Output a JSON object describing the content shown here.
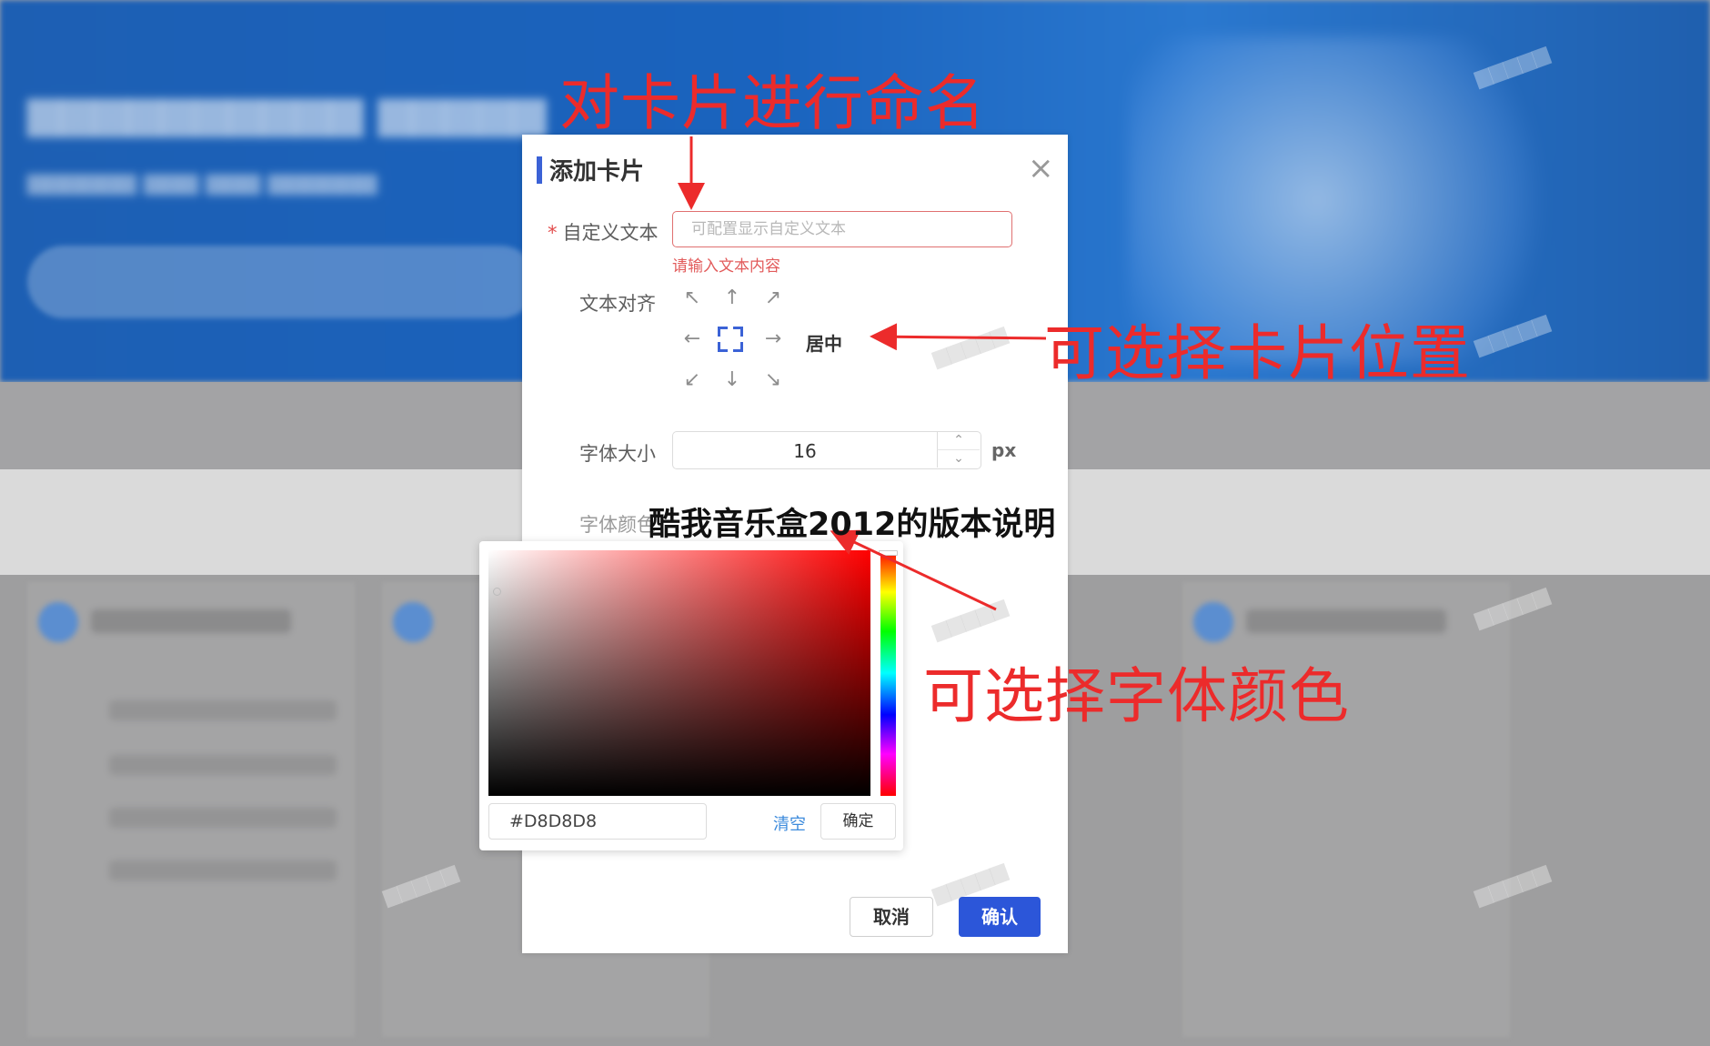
{
  "dialog": {
    "title": "添加卡片",
    "close_icon": "close-icon",
    "custom_text": {
      "label": "自定义文本",
      "required_mark": "*",
      "placeholder": "可配置显示自定义文本",
      "value": "",
      "error": "请输入文本内容"
    },
    "text_align": {
      "label": "文本对齐",
      "selected": "居中",
      "options": [
        "top-left",
        "top",
        "top-right",
        "left",
        "center",
        "right",
        "bottom-left",
        "bottom",
        "bottom-right"
      ]
    },
    "font_size": {
      "label": "字体大小",
      "value": "16",
      "unit": "px"
    },
    "font_color": {
      "label": "字体颜色"
    },
    "cancel_label": "取消",
    "confirm_label": "确认"
  },
  "color_picker": {
    "hue_color": "#FF0000",
    "hex_value": "#D8D8D8",
    "clear_label": "清空",
    "ok_label": "确定"
  },
  "annotations": {
    "rename_card": "对卡片进行命名",
    "choose_position": "可选择卡片位置",
    "choose_font_color": "可选择字体颜色",
    "annotation_color": "#EC2B2B"
  },
  "overlay_caption": "酷我音乐盒2012的版本说明"
}
